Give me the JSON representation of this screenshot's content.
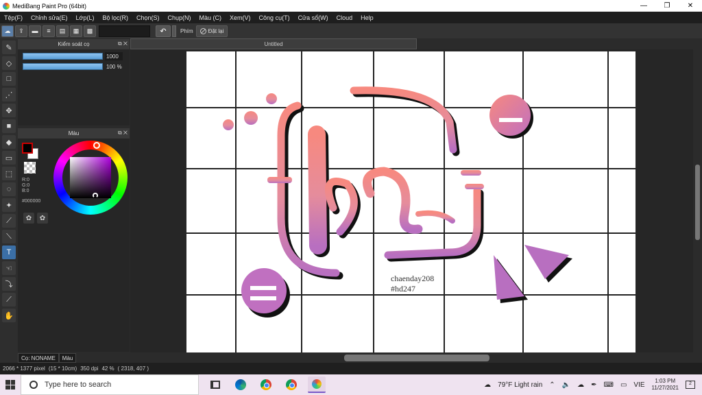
{
  "window": {
    "title": "MediBang Paint Pro (64bit)",
    "minimize": "—",
    "restore": "❐",
    "close": "✕"
  },
  "menu": [
    "Tệp(F)",
    "Chỉnh sửa(E)",
    "Lớp(L)",
    "Bộ lọc(R)",
    "Chọn(S)",
    "Chụp(N)",
    "Màu (C)",
    "Xem(V)",
    "Công cụ(T)",
    "Cửa sổ(W)",
    "Cloud",
    "Help"
  ],
  "toolbar": {
    "undo_icon": "undo-arrow-icon",
    "shortcut_label": "Phím",
    "reset_label": "Đặt lại"
  },
  "brush_panel": {
    "title": "Kiểm soát cọ",
    "size_value": "1000",
    "opacity_value": "100 %"
  },
  "color_panel": {
    "title": "Màu",
    "r": "R:0",
    "g": "G:0",
    "b": "B:0",
    "hex": "#000000",
    "fg_color": "#000000",
    "bg_color": "#ffffff"
  },
  "bottom_tabs": [
    "Cọ: NONAME",
    "Màu"
  ],
  "document": {
    "tab_title": "Untitled"
  },
  "artwork": {
    "watermark_line1": "chaenday208",
    "watermark_line2": "#hd247"
  },
  "status": {
    "size": "2066 * 1377 pixel",
    "physical": "(15 * 10cm)",
    "dpi": "350 dpi",
    "zoom": "42 %",
    "cursor": "( 2318, 407 )"
  },
  "taskbar": {
    "search_placeholder": "Type here to search",
    "weather": "79°F  Light rain",
    "lang": "VIE",
    "time": "1:03 PM",
    "date": "11/27/2021",
    "notif_count": "2"
  }
}
